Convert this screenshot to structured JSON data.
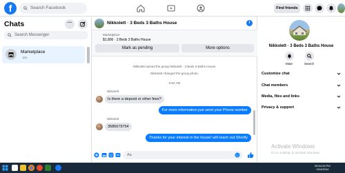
{
  "topbar": {
    "search_placeholder": "Search Facebook",
    "find_friends": "Find friends"
  },
  "left": {
    "title": "Chats",
    "search_placeholder": "Search Messenger",
    "chats": [
      {
        "name": "Marketplace",
        "time": "· 1m"
      }
    ]
  },
  "conversation": {
    "title": "Nikkolett · 3 Beds 3 Baths House",
    "listing_label": "Marketplace",
    "listing_detail": "$1,800 · 3 Beds 3 Baths House",
    "btn_pending": "Mark as pending",
    "btn_options": "More options",
    "system_messages": [
      "Nikkolett named the group Nikkolett · 3 Beds 3 Baths House.",
      "Nikkolett changed the group photo."
    ],
    "timestamp": "5:52 AM",
    "messages": [
      {
        "sender": "Nikkolett",
        "text": "Is there a deposit or other fees?",
        "direction": "in"
      },
      {
        "text": "For more information just send your Phone number",
        "direction": "out"
      },
      {
        "sender": "Nikkolett",
        "text": "3585679754",
        "direction": "in"
      },
      {
        "text": "Thanks for your interest in the house! will reach out Shortly",
        "direction": "out"
      }
    ],
    "composer_placeholder": "Aa"
  },
  "right": {
    "name": "Nikkolett · 3 Beds 3 Baths House",
    "actions": [
      "Mute",
      "Search"
    ],
    "sections": [
      "Customize chat",
      "Chat members",
      "Media, files and links",
      "Privacy & support"
    ]
  },
  "watermark": {
    "title": "Activate Windows",
    "subtitle": "Go to Settings to activate Windows."
  },
  "taskbar": {
    "time": "05:54:26 PM",
    "date": "10/4/2024"
  },
  "colors": {
    "brand": "#1877f2",
    "outgoing_bubble": "#0a7cff",
    "incoming_bubble": "#e4e6eb",
    "selected_chat": "#e7f3ff"
  }
}
